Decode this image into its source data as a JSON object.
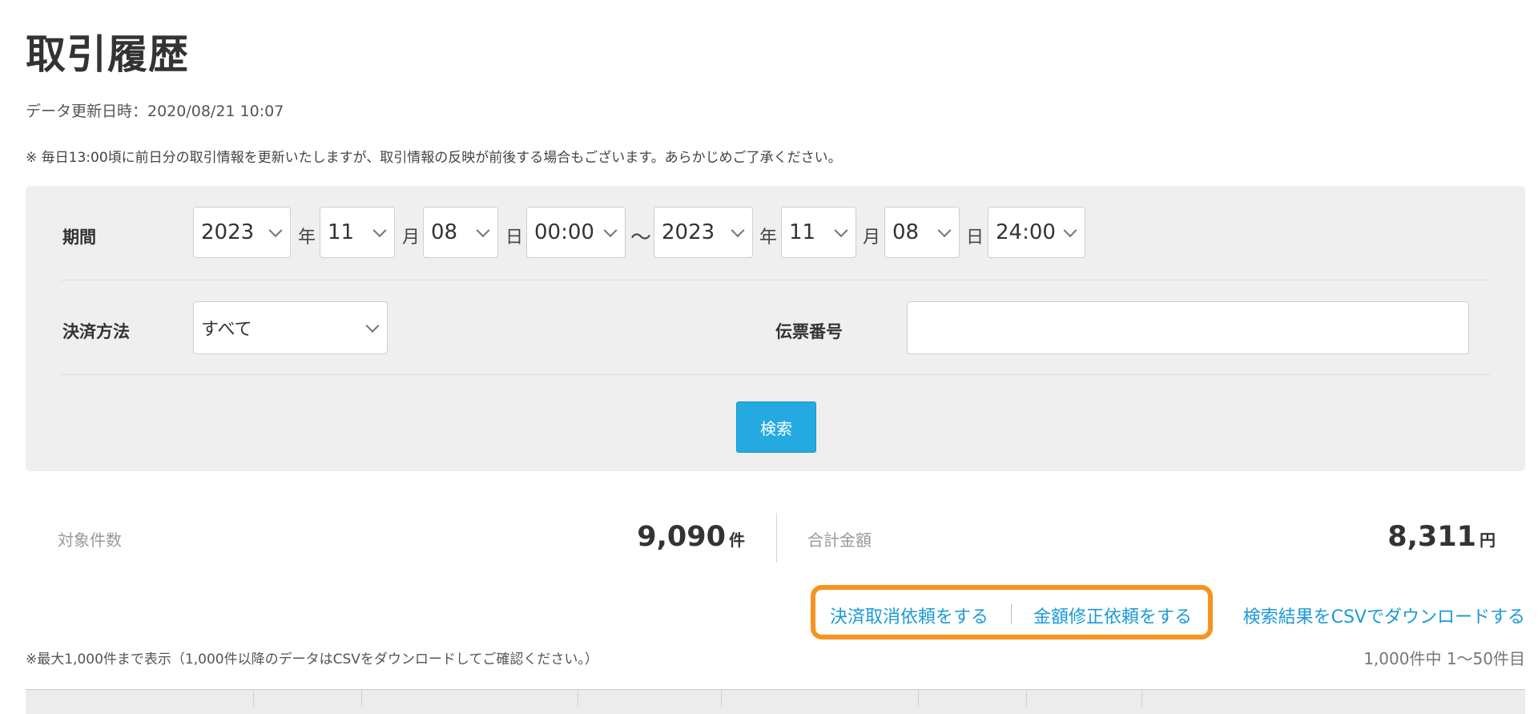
{
  "page": {
    "title": "取引履歴",
    "updated": "データ更新日時：2020/08/21 10:07",
    "note": "※ 毎日13:00頃に前日分の取引情報を更新いたしますが、取引情報の反映が前後する場合もございます。あらかじめご了承ください。"
  },
  "filter": {
    "period_label": "期間",
    "from": {
      "year": "2023",
      "month": "11",
      "day": "08",
      "time": "00:00"
    },
    "to": {
      "year": "2023",
      "month": "11",
      "day": "08",
      "time": "24:00"
    },
    "unit_year": "年",
    "unit_month": "月",
    "unit_day": "日",
    "range_sep": "〜",
    "method_label": "決済方法",
    "method_value": "すべて",
    "slip_label": "伝票番号",
    "slip_value": "",
    "search_label": "検索"
  },
  "summary": {
    "count_label": "対象件数",
    "count_value": "9,090",
    "count_unit": "件",
    "total_label": "合計金額",
    "total_value": "8,311",
    "total_unit": "円"
  },
  "actions": {
    "cancel_request": "決済取消依頼をする",
    "amount_fix_request": "金額修正依頼をする",
    "csv_download": "検索結果をCSVでダウンロードする"
  },
  "list": {
    "limit_note": "※最大1,000件まで表示（1,000件以降のデータはCSVをダウンロードしてご確認ください。）",
    "paging": "1,000件中  1〜50件目"
  },
  "colors": {
    "accent": "#24a9e1",
    "link": "#1c9ad6",
    "highlight": "#f7931e"
  }
}
